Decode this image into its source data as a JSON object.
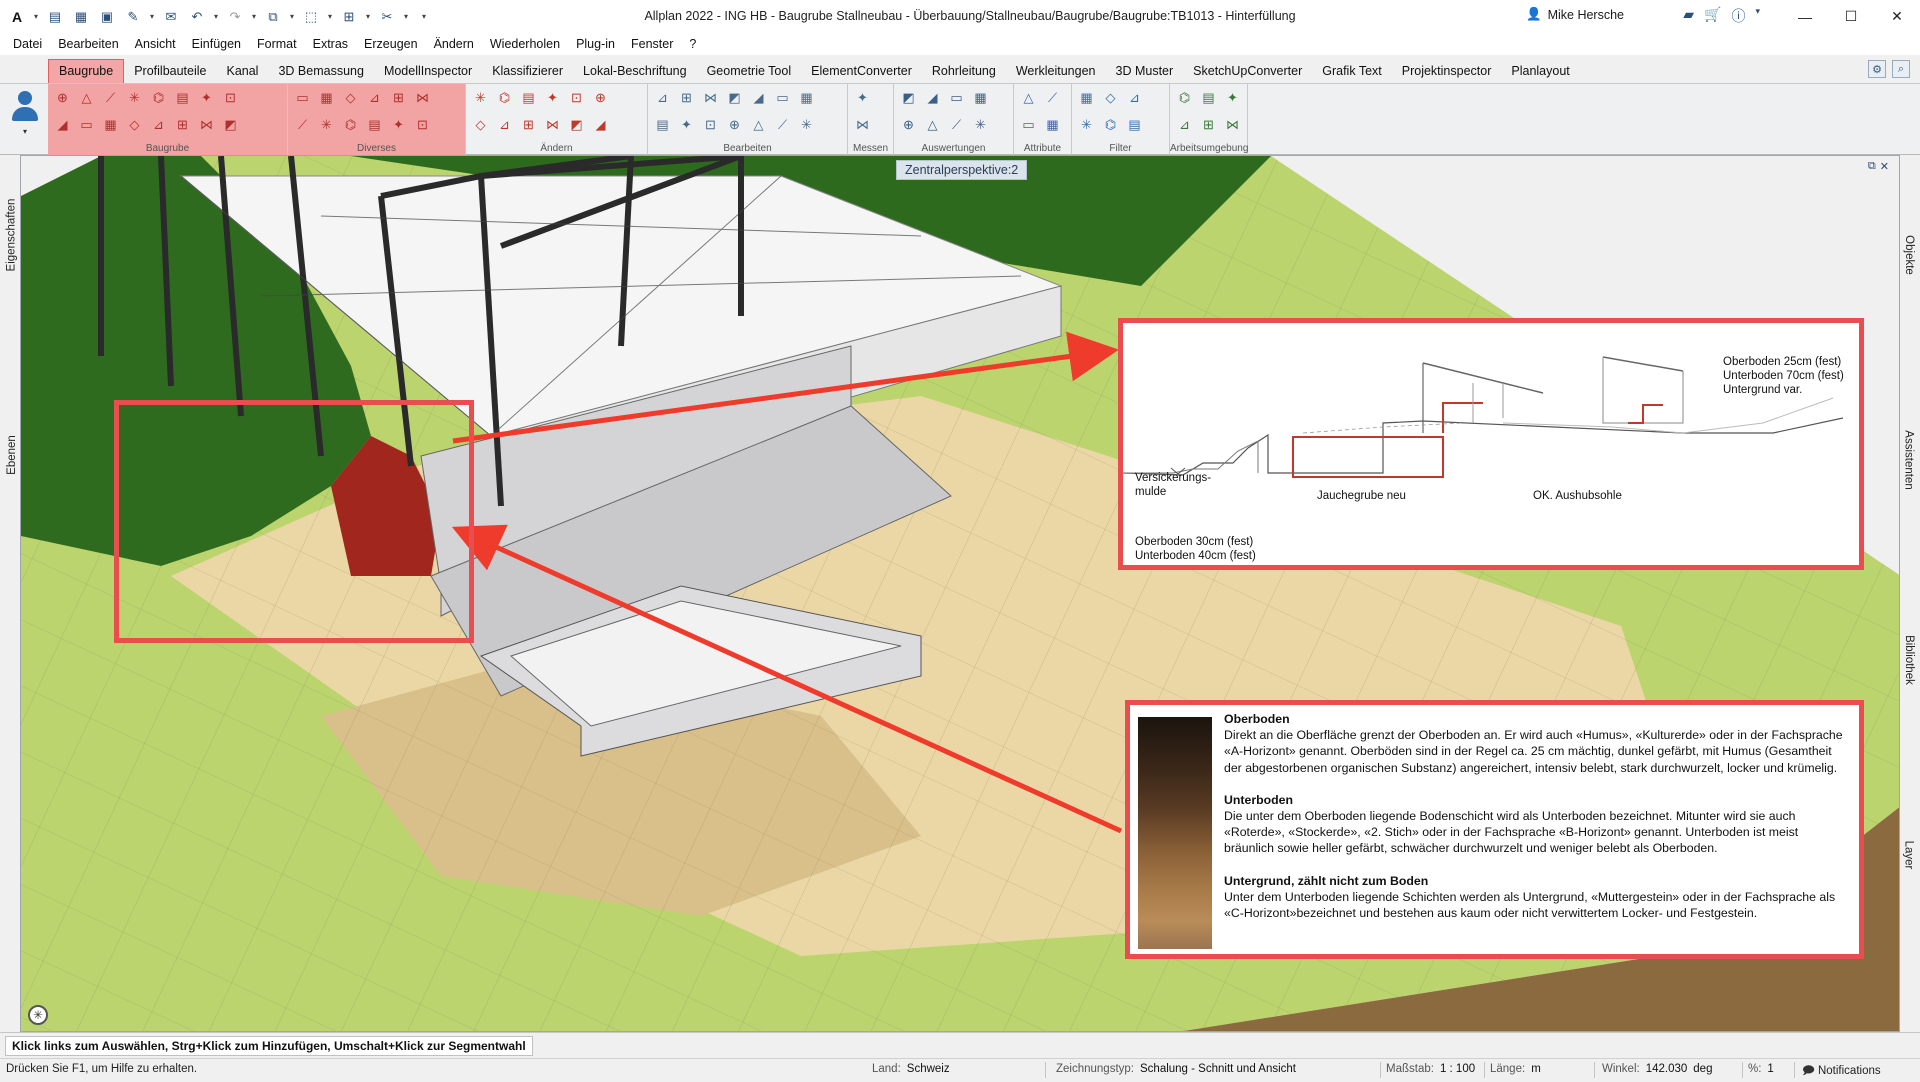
{
  "titlebar": {
    "app_logo": "A",
    "title": "Allplan 2022 - ING HB - Baugrube Stallneubau - Überbauung/Stallneubau/Baugrube/Baugrube:TB1013 - Hinterfüllung",
    "user_name": "Mike Hersche",
    "help_label": "?"
  },
  "menu": [
    "Datei",
    "Bearbeiten",
    "Ansicht",
    "Einfügen",
    "Format",
    "Extras",
    "Erzeugen",
    "Ändern",
    "Wiederholen",
    "Plug-in",
    "Fenster",
    "?"
  ],
  "ribbon": {
    "tabs": [
      "Baugrube",
      "Profilbauteile",
      "Kanal",
      "3D Bemassung",
      "ModellInspector",
      "Klassifizierer",
      "Lokal-Beschriftung",
      "Geometrie Tool",
      "ElementConverter",
      "Rohrleitung",
      "Werkleitungen",
      "3D Muster",
      "SketchUpConverter",
      "Grafik Text",
      "Projektinspector",
      "Planlayout"
    ],
    "active_tab": "Baugrube",
    "groups": [
      "Baugrube",
      "Diverses",
      "Ändern",
      "Bearbeiten",
      "Messen",
      "Auswertungen",
      "Attribute",
      "Filter",
      "Arbeitsumgebung"
    ]
  },
  "viewport": {
    "view_name": "Zentralperspektive:2",
    "left_tabs": [
      "Eigenschaften",
      "Ebenen"
    ],
    "right_tabs": [
      "Objekte",
      "Assistenten",
      "Bibliothek",
      "Layer"
    ]
  },
  "section_callout": {
    "top_right": [
      "Oberboden  25cm (fest)",
      "Unterboden 70cm (fest)",
      "Untergrund var."
    ],
    "mulde": [
      "Versickerungs-",
      "mulde"
    ],
    "jauchegrube": "Jauchegrube neu",
    "aushubsohle": "OK. Aushubsohle",
    "bottom_left": [
      "Oberboden  30cm (fest)",
      "Unterboden 40cm (fest)"
    ]
  },
  "soil_callout": {
    "sections": [
      {
        "title": "Oberboden",
        "text": "Direkt an die Oberfläche grenzt der Oberboden an. Er wird auch «Humus», «Kulturerde» oder in der Fachsprache «A-Horizont» genannt. Oberböden sind in der Regel ca. 25 cm mächtig, dunkel gefärbt, mit Humus (Gesamtheit der abgestorbenen organischen Substanz) angereichert, intensiv belebt, stark durchwurzelt, locker und krümelig."
      },
      {
        "title": "Unterboden",
        "text": "Die unter dem Oberboden liegende Bodenschicht wird als Unterboden bezeichnet. Mitunter wird sie auch «Roterde», «Stockerde», «2. Stich» oder in der Fachsprache «B-Horizont» genannt. Unterboden ist meist bräunlich sowie heller gefärbt, schwächer durchwurzelt und weniger belebt als Oberboden."
      },
      {
        "title": "Untergrund, zählt nicht zum Boden",
        "text": "Unter dem Unterboden liegende Schichten werden als Untergrund, «Muttergestein» oder in der Fachsprache als «C-Horizont»bezeichnet und bestehen aus kaum oder nicht verwittertem Locker- und Festgestein."
      }
    ]
  },
  "hint": "Klick links zum Auswählen, Strg+Klick zum Hinzufügen, Umschalt+Klick zur Segmentwahl",
  "status": {
    "help": "Drücken Sie F1, um Hilfe zu erhalten.",
    "land_label": "Land:",
    "land_value": "Schweiz",
    "zeichnungstyp_label": "Zeichnungstyp:",
    "zeichnungstyp_value": "Schalung - Schnitt und Ansicht",
    "massstab_label": "Maßstab:",
    "massstab_value": "1 : 100",
    "laenge_label": "Länge:",
    "laenge_value": "m",
    "winkel_label": "Winkel:",
    "winkel_value": "142.030",
    "winkel_unit": "deg",
    "percent_label": "%:",
    "percent_value": "1",
    "notifications": "Notifications"
  },
  "colors": {
    "accent_red": "#e84e50",
    "ribbon_highlight": "#f2a3a3",
    "grass": "#b9d36c",
    "dark_green": "#2f6b1f",
    "sand": "#e8d5a3"
  }
}
